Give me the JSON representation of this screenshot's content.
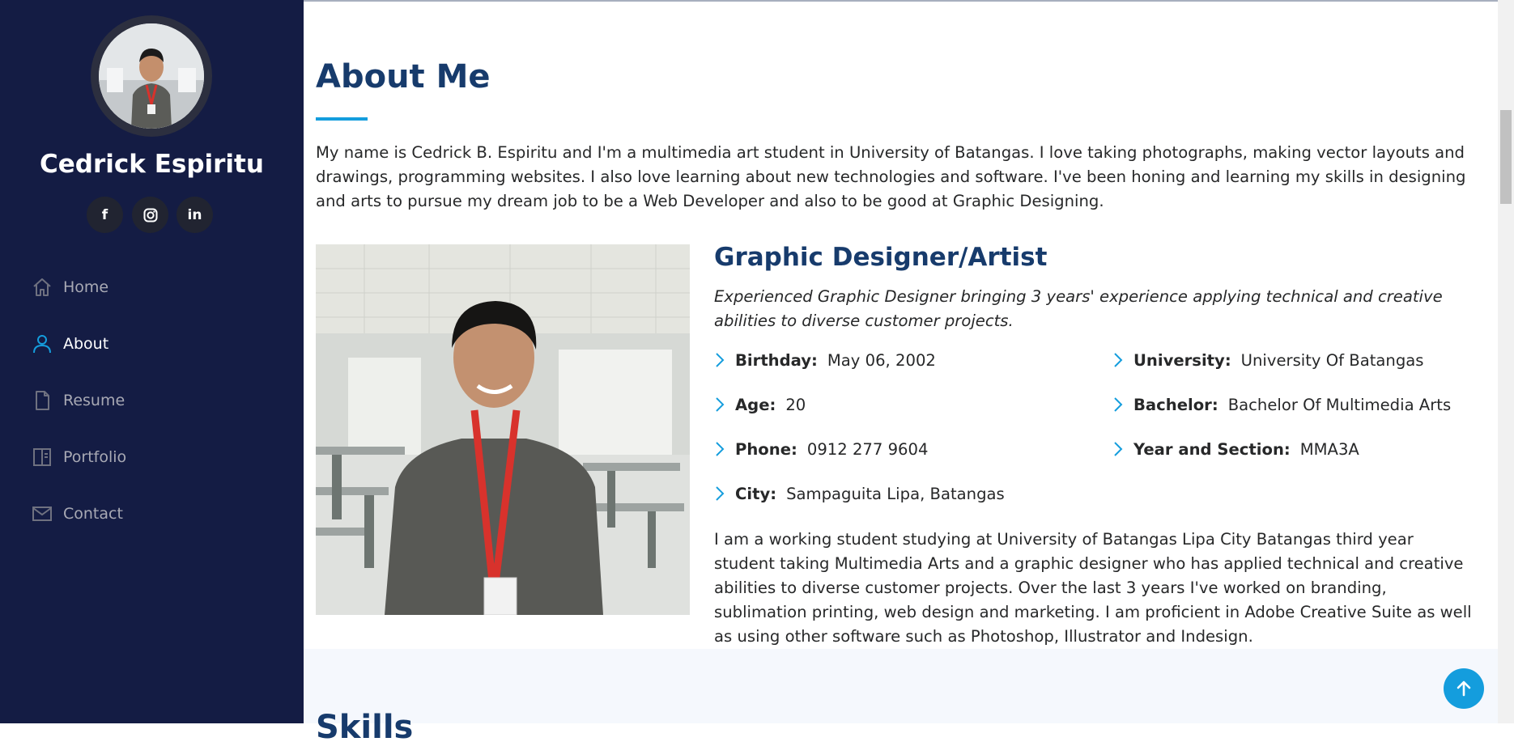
{
  "sidebar": {
    "name": "Cedrick Espiritu",
    "social": [
      {
        "icon": "facebook-icon",
        "label": "f"
      },
      {
        "icon": "instagram-icon",
        "label": ""
      },
      {
        "icon": "linkedin-icon",
        "label": "in"
      }
    ],
    "nav": [
      {
        "label": "Home",
        "icon": "home-icon",
        "active": false
      },
      {
        "label": "About",
        "icon": "person-icon",
        "active": true
      },
      {
        "label": "Resume",
        "icon": "file-icon",
        "active": false
      },
      {
        "label": "Portfolio",
        "icon": "book-icon",
        "active": false
      },
      {
        "label": "Contact",
        "icon": "envelope-icon",
        "active": false
      }
    ]
  },
  "about": {
    "title": "About Me",
    "intro": "My name is Cedrick B. Espiritu and I'm a multimedia art student in University of Batangas. I love taking photographs, making vector layouts and drawings, programming websites. I also love learning about new technologies and software. I've been honing and learning my skills in designing and arts to pursue my dream job to be a Web Developer and also to be good at Graphic Designing.",
    "role": "Graphic Designer/Artist",
    "role_desc": "Experienced Graphic Designer bringing 3 years' experience applying technical and creative abilities to diverse customer projects.",
    "info": {
      "birthday": {
        "label": "Birthday:",
        "value": "May 06, 2002"
      },
      "age": {
        "label": "Age:",
        "value": "20"
      },
      "phone": {
        "label": "Phone:",
        "value": "0912 277 9604"
      },
      "city": {
        "label": "City:",
        "value": "Sampaguita Lipa, Batangas"
      },
      "university": {
        "label": "University:",
        "value": "University Of Batangas"
      },
      "bachelor": {
        "label": "Bachelor:",
        "value": "Bachelor Of Multimedia Arts"
      },
      "year": {
        "label": "Year and Section:",
        "value": "MMA3A"
      }
    },
    "bio": "I am a working student studying at University of Batangas Lipa City Batangas third year student taking Multimedia Arts and a graphic designer who has applied technical and creative abilities to diverse customer projects. Over the last 3 years I've worked on branding, sublimation printing, web design and marketing. I am proficient in Adobe Creative Suite as well as using other software such as Photoshop, Illustrator and Indesign."
  },
  "skills": {
    "title": "Skills"
  },
  "colors": {
    "sidebar_bg": "#141c44",
    "accent": "#149ddd",
    "heading": "#173b6c"
  }
}
